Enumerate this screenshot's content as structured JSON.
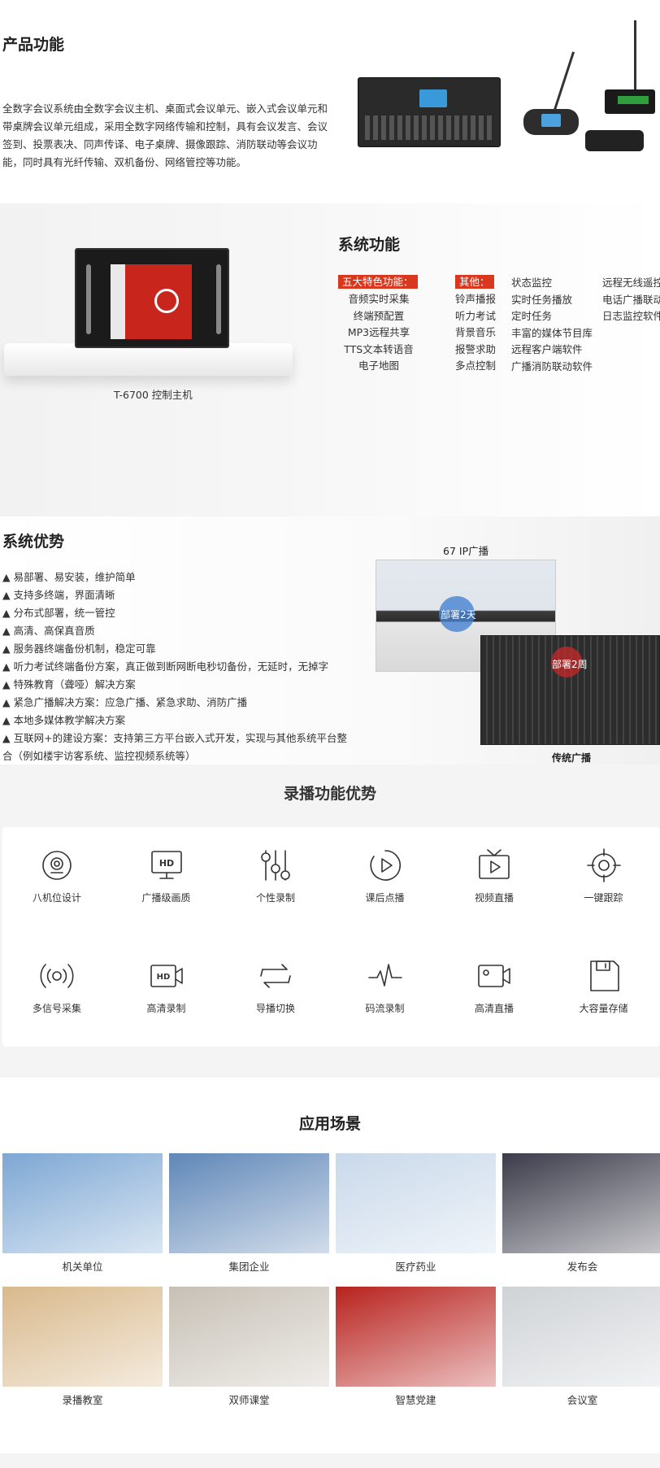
{
  "product": {
    "title": "产品功能",
    "desc": "全数字会议系统由全数字会议主机、桌面式会议单元、嵌入式会议单元和带桌牌会议单元组成，采用全数字网络传输和控制，具有会议发言、会议签到、投票表决、同声传译、电子桌牌、摄像跟踪、消防联动等会议功能，同时具有光纤传输、双机备份、网络管控等功能。"
  },
  "system": {
    "title": "系统功能",
    "caption": "T-6700 控制主机",
    "features_label": "五大特色功能：",
    "features": [
      "音频实时采集",
      "终端预配置",
      "MP3远程共享",
      "TTS文本转语音",
      "电子地图"
    ],
    "others_label": "其他：",
    "others_col1": [
      "铃声播报",
      "听力考试",
      "背景音乐",
      "报警求助",
      "多点控制"
    ],
    "others_col2": [
      "状态监控",
      "实时任务播放",
      "定时任务",
      "丰富的媒体节目库",
      "远程客户端软件",
      "广播消防联动软件"
    ],
    "others_col3": [
      "远程无线遥控",
      "电话广播联动",
      "日志监控软件"
    ]
  },
  "advantages": {
    "title": "系统优势",
    "items": [
      "▲ 易部署、易安装，维护简单",
      "▲ 支持多终端，界面清晰",
      "▲ 分布式部署，统一管控",
      "▲ 高清、高保真音质",
      "▲ 服务器终端备份机制，稳定可靠",
      "▲ 听力考试终端备份方案，真正做到断网断电秒切备份，无延时，无掉字",
      "▲ 特殊教育（聋哑）解决方案",
      "▲ 紧急广播解决方案：应急广播、紧急求助、消防广播",
      "▲ 本地多媒体教学解决方案",
      "▲ 互联网+的建设方案：支持第三方平台嵌入式开发，实现与其他系统平台整合（例如楼宇访客系统、监控视频系统等）"
    ],
    "ip_label": "67 IP广播",
    "deploy1": "部署2天",
    "deploy2": "部署2周",
    "traditional_label": "传统广播"
  },
  "recording": {
    "title": "录播功能优势",
    "features": [
      {
        "label": "八机位设计",
        "icon": "camera-position-icon"
      },
      {
        "label": "广播级画质",
        "icon": "hd-monitor-icon"
      },
      {
        "label": "个性录制",
        "icon": "sliders-icon"
      },
      {
        "label": "课后点播",
        "icon": "play-circle-icon"
      },
      {
        "label": "视频直播",
        "icon": "tv-play-icon"
      },
      {
        "label": "一键跟踪",
        "icon": "crosshair-icon"
      },
      {
        "label": "多信号采集",
        "icon": "signal-icon"
      },
      {
        "label": "高清录制",
        "icon": "hd-camera-icon"
      },
      {
        "label": "导播切换",
        "icon": "switch-arrows-icon"
      },
      {
        "label": "码流录制",
        "icon": "waveform-icon"
      },
      {
        "label": "高清直播",
        "icon": "video-camera-icon"
      },
      {
        "label": "大容量存储",
        "icon": "save-disk-icon"
      }
    ]
  },
  "scenes": {
    "title": "应用场景",
    "items": [
      {
        "label": "机关单位",
        "color": "#7da7d4"
      },
      {
        "label": "集团企业",
        "color": "#5f87b8"
      },
      {
        "label": "医疗药业",
        "color": "#c9d9ea"
      },
      {
        "label": "发布会",
        "color": "#3b3b4a"
      },
      {
        "label": "录播教室",
        "color": "#d9b98c"
      },
      {
        "label": "双师课堂",
        "color": "#c7c0b5"
      },
      {
        "label": "智慧党建",
        "color": "#b8221e"
      },
      {
        "label": "会议室",
        "color": "#cfd3d6"
      }
    ]
  }
}
